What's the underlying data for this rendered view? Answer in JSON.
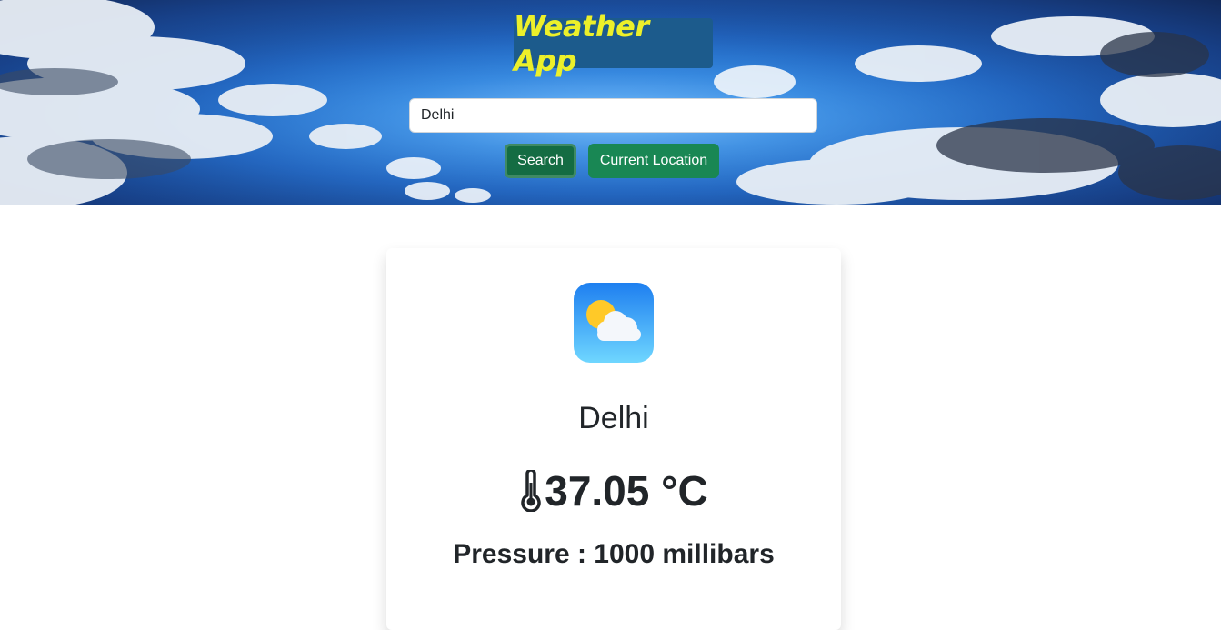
{
  "header": {
    "title": "Weather App",
    "background": "sky-clouds-image"
  },
  "search": {
    "value": "Delhi",
    "button_label": "Search",
    "location_button_label": "Current Location"
  },
  "weather": {
    "icon": "partly-cloudy-icon",
    "city": "Delhi",
    "temperature": "37.05 °C",
    "temperature_icon": "thermometer-icon",
    "pressure": "Pressure : 1000 millibars"
  },
  "colors": {
    "title_text": "#ecf02a",
    "title_bg": "#1c5b8c",
    "button_green": "#198754",
    "button_green_active": "#146c43",
    "text_dark": "#212529"
  }
}
